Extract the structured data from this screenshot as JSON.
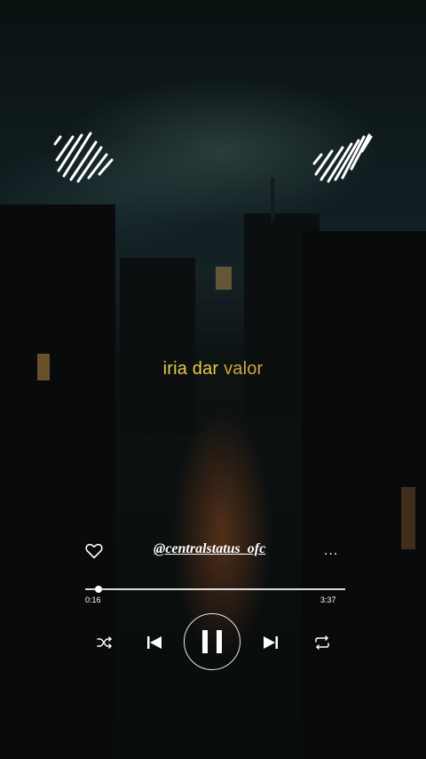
{
  "lyric": {
    "part1": "iria dar",
    "part2": "valor"
  },
  "player": {
    "handle": "@centralstatus_ofc",
    "more_label": "...",
    "time_current": "0:16",
    "time_total": "3:37",
    "progress_fraction": 0.05
  },
  "icons": {
    "like": "heart-icon",
    "shuffle": "shuffle-icon",
    "previous": "skip-previous-icon",
    "play_pause": "pause-icon",
    "next": "skip-next-icon",
    "repeat": "repeat-icon",
    "decoration_left": "sound-wave-icon",
    "decoration_right": "sound-wave-icon"
  },
  "colors": {
    "lyric": "#e8c94a",
    "ui": "#ffffff"
  }
}
